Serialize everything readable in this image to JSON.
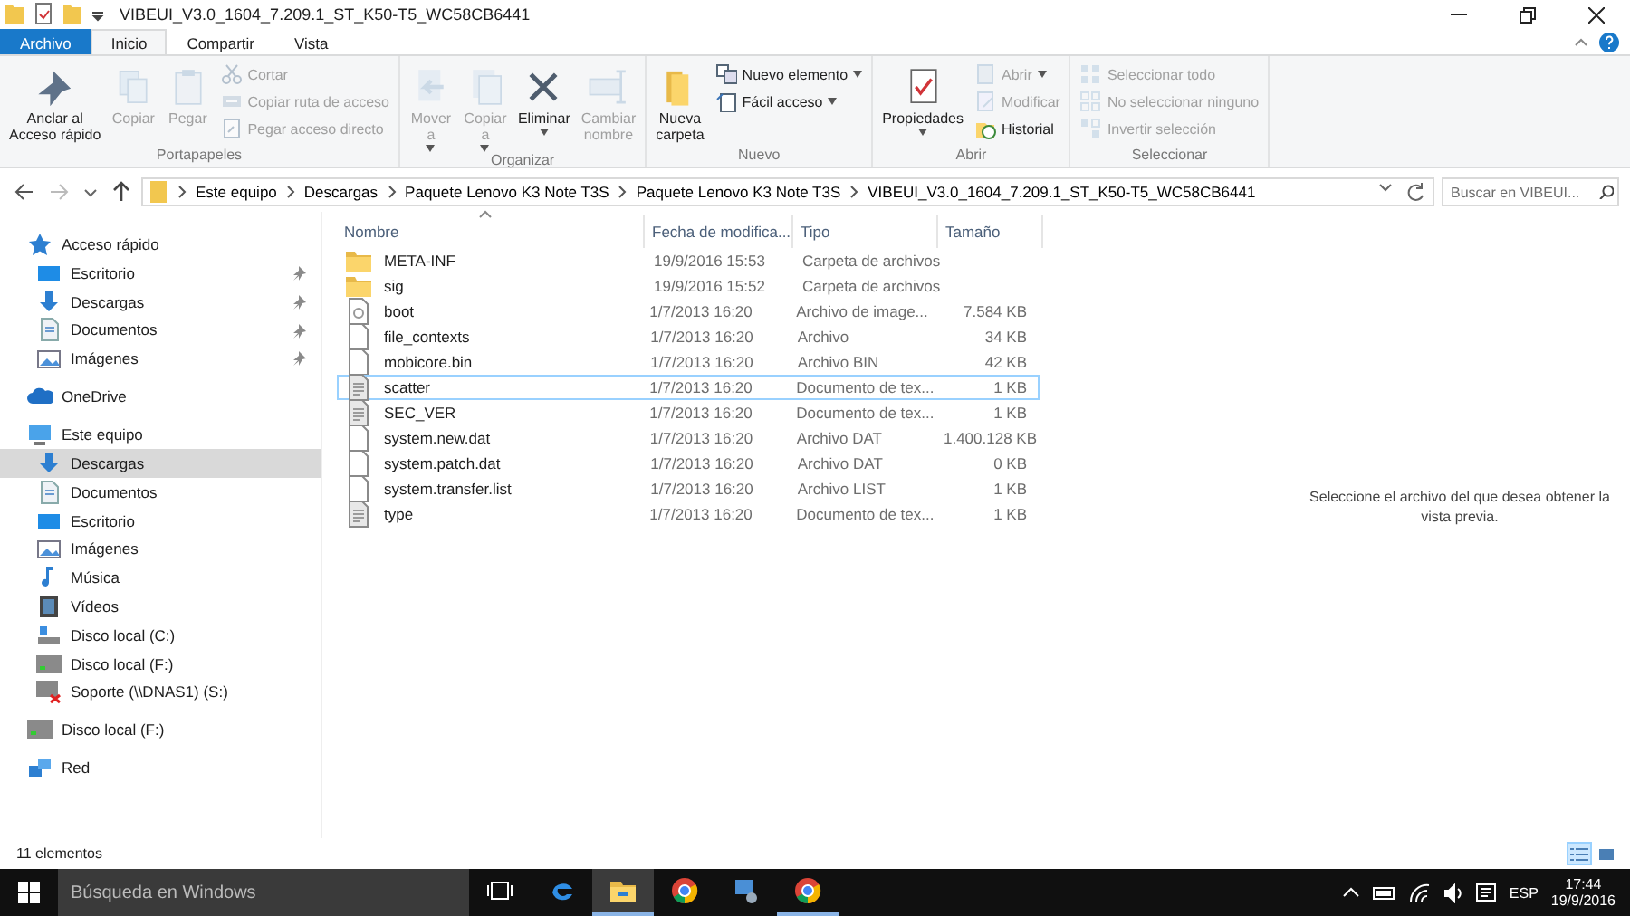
{
  "window": {
    "title": "VIBEUI_V3.0_1604_7.209.1_ST_K50-T5_WC58CB6441"
  },
  "tabs": [
    {
      "label": "Archivo",
      "kind": "file",
      "selected": false
    },
    {
      "label": "Inicio",
      "kind": "tab",
      "selected": true
    },
    {
      "label": "Compartir",
      "kind": "tab",
      "selected": false
    },
    {
      "label": "Vista",
      "kind": "tab",
      "selected": false
    }
  ],
  "ribbon": {
    "groups": [
      {
        "label": "Portapapeles",
        "items": [
          {
            "kind": "large",
            "label": "Anclar al\nAcceso rápido",
            "disabled": false,
            "dropdown": false
          },
          {
            "kind": "large",
            "label": "Copiar",
            "disabled": true,
            "dropdown": false
          },
          {
            "kind": "large",
            "label": "Pegar",
            "disabled": true,
            "dropdown": false
          },
          {
            "kind": "small",
            "label": "Cortar",
            "disabled": true,
            "dropdown": false
          },
          {
            "kind": "small",
            "label": "Copiar ruta de acceso",
            "disabled": true,
            "dropdown": false
          },
          {
            "kind": "small",
            "label": "Pegar acceso directo",
            "disabled": true,
            "dropdown": false
          }
        ]
      },
      {
        "label": "Organizar",
        "items": [
          {
            "kind": "large",
            "label": "Mover\na",
            "disabled": true,
            "dropdown": true
          },
          {
            "kind": "large",
            "label": "Copiar\na",
            "disabled": true,
            "dropdown": true
          },
          {
            "kind": "large",
            "label": "Eliminar",
            "disabled": false,
            "dropdown": true
          },
          {
            "kind": "large",
            "label": "Cambiar\nnombre",
            "disabled": true,
            "dropdown": false
          }
        ]
      },
      {
        "label": "Nuevo",
        "items": [
          {
            "kind": "large",
            "label": "Nueva\ncarpeta",
            "disabled": false,
            "dropdown": false
          },
          {
            "kind": "small",
            "label": "Nuevo elemento",
            "disabled": false,
            "dropdown": true
          },
          {
            "kind": "small",
            "label": "Fácil acceso",
            "disabled": false,
            "dropdown": true
          }
        ]
      },
      {
        "label": "Abrir",
        "items": [
          {
            "kind": "large",
            "label": "Propiedades",
            "disabled": false,
            "dropdown": true
          },
          {
            "kind": "small",
            "label": "Abrir",
            "disabled": true,
            "dropdown": true
          },
          {
            "kind": "small",
            "label": "Modificar",
            "disabled": true,
            "dropdown": false
          },
          {
            "kind": "small",
            "label": "Historial",
            "disabled": false,
            "dropdown": false
          }
        ]
      },
      {
        "label": "Seleccionar",
        "items": [
          {
            "kind": "small",
            "label": "Seleccionar todo",
            "disabled": true,
            "dropdown": false
          },
          {
            "kind": "small",
            "label": "No seleccionar ninguno",
            "disabled": true,
            "dropdown": false
          },
          {
            "kind": "small",
            "label": "Invertir selección",
            "disabled": true,
            "dropdown": false
          }
        ]
      }
    ]
  },
  "address": {
    "path": [
      "Este equipo",
      "Descargas",
      "Paquete Lenovo K3 Note T3S",
      "Paquete Lenovo K3 Note T3S",
      "VIBEUI_V3.0_1604_7.209.1_ST_K50-T5_WC58CB6441"
    ],
    "search_placeholder": "Buscar en VIBEUI..."
  },
  "sidebar": {
    "items": [
      {
        "label": "Acceso rápido",
        "kind": "star",
        "selected": false,
        "children": [
          {
            "label": "Escritorio",
            "kind": "desktop",
            "pinned": true,
            "selected": false
          },
          {
            "label": "Descargas",
            "kind": "download",
            "pinned": true,
            "selected": false
          },
          {
            "label": "Documentos",
            "kind": "document",
            "pinned": true,
            "selected": false
          },
          {
            "label": "Imágenes",
            "kind": "images",
            "pinned": true,
            "selected": false
          }
        ]
      },
      {
        "label": "OneDrive",
        "kind": "cloud",
        "selected": false
      },
      {
        "label": "Este equipo",
        "kind": "pc",
        "selected": false,
        "children": [
          {
            "label": "Descargas",
            "kind": "download",
            "pinned": false,
            "selected": true
          },
          {
            "label": "Documentos",
            "kind": "document",
            "pinned": false,
            "selected": false
          },
          {
            "label": "Escritorio",
            "kind": "desktop",
            "pinned": false,
            "selected": false
          },
          {
            "label": "Imágenes",
            "kind": "images",
            "pinned": false,
            "selected": false
          },
          {
            "label": "Música",
            "kind": "music",
            "pinned": false,
            "selected": false
          },
          {
            "label": "Vídeos",
            "kind": "video",
            "pinned": false,
            "selected": false
          },
          {
            "label": "Disco local (C:)",
            "kind": "sysdrive",
            "pinned": false,
            "selected": false
          },
          {
            "label": "Disco local (F:)",
            "kind": "drive",
            "pinned": false,
            "selected": false
          },
          {
            "label": "Soporte (\\\\DNAS1) (S:)",
            "kind": "netdrive",
            "pinned": false,
            "selected": false
          }
        ]
      },
      {
        "label": "Disco local (F:)",
        "kind": "drive",
        "selected": false
      },
      {
        "label": "Red",
        "kind": "network",
        "selected": false
      }
    ]
  },
  "table": {
    "columns": [
      {
        "label": "Nombre",
        "sorted": true
      },
      {
        "label": "Fecha de modifica...",
        "sorted": false
      },
      {
        "label": "Tipo",
        "sorted": false
      },
      {
        "label": "Tamaño",
        "sorted": false
      }
    ],
    "rows": [
      {
        "kind": "folder",
        "name": "META-INF",
        "date": "19/9/2016 15:53",
        "type": "Carpeta de archivos",
        "focused": false,
        "selected": false
      },
      {
        "kind": "folder",
        "name": "sig",
        "date": "19/9/2016 15:52",
        "type": "Carpeta de archivos",
        "focused": false,
        "selected": false
      },
      {
        "kind": "image",
        "name": "boot",
        "date": "1/7/2013 16:20",
        "type": "Archivo de image...",
        "size": "7.584 KB",
        "focused": false,
        "selected": false
      },
      {
        "kind": "file",
        "name": "file_contexts",
        "date": "1/7/2013 16:20",
        "type": "Archivo",
        "size": "34 KB",
        "focused": false,
        "selected": false
      },
      {
        "kind": "file",
        "name": "mobicore.bin",
        "date": "1/7/2013 16:20",
        "type": "Archivo BIN",
        "size": "42 KB",
        "focused": false,
        "selected": false
      },
      {
        "kind": "text",
        "name": "scatter",
        "date": "1/7/2013 16:20",
        "type": "Documento de tex...",
        "size": "1 KB",
        "focused": true,
        "selected": false
      },
      {
        "kind": "text",
        "name": "SEC_VER",
        "date": "1/7/2013 16:20",
        "type": "Documento de tex...",
        "size": "1 KB",
        "focused": false,
        "selected": false
      },
      {
        "kind": "file",
        "name": "system.new.dat",
        "date": "1/7/2013 16:20",
        "type": "Archivo DAT",
        "size": "1.400.128 KB",
        "focused": false,
        "selected": false
      },
      {
        "kind": "file",
        "name": "system.patch.dat",
        "date": "1/7/2013 16:20",
        "type": "Archivo DAT",
        "size": "0 KB",
        "focused": false,
        "selected": false
      },
      {
        "kind": "file",
        "name": "system.transfer.list",
        "date": "1/7/2013 16:20",
        "type": "Archivo LIST",
        "size": "1 KB",
        "focused": false,
        "selected": false
      },
      {
        "kind": "text",
        "name": "type",
        "date": "1/7/2013 16:20",
        "type": "Documento de tex...",
        "size": "1 KB",
        "focused": false,
        "selected": false
      }
    ]
  },
  "preview": {
    "message": "Seleccione el archivo del que desea obtener la vista previa."
  },
  "status_bar": {
    "count": "11 elementos",
    "views": [
      {
        "kind": "details",
        "selected": true
      },
      {
        "kind": "large",
        "selected": false
      }
    ]
  },
  "taskbar": {
    "search_placeholder": "Búsqueda en Windows",
    "apps": [
      {
        "kind": "edge",
        "active": false,
        "running": false
      },
      {
        "kind": "explorer",
        "active": true,
        "running": true
      },
      {
        "kind": "chrome",
        "active": false,
        "running": false
      },
      {
        "kind": "network",
        "active": false,
        "running": false
      },
      {
        "kind": "chrome",
        "active": false,
        "running": true
      }
    ],
    "language": "ESP",
    "time": "17:44",
    "date": "19/9/2016"
  }
}
